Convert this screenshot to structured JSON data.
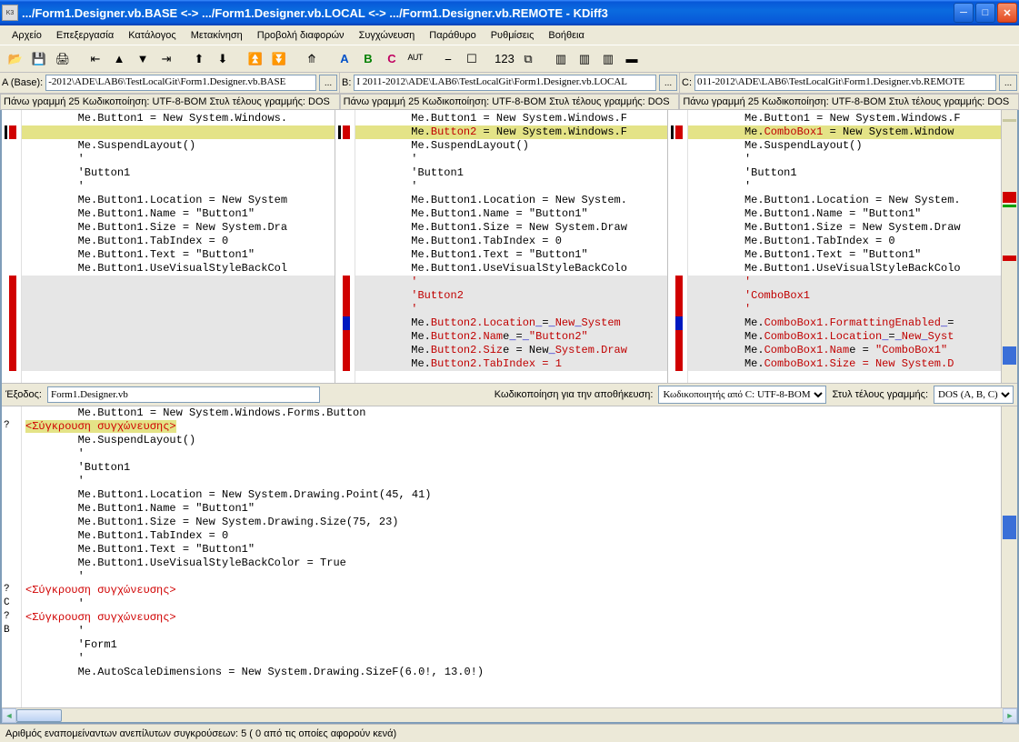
{
  "window": {
    "title": ".../Form1.Designer.vb.BASE <-> .../Form1.Designer.vb.LOCAL <-> .../Form1.Designer.vb.REMOTE - KDiff3",
    "appicon_text": "K3"
  },
  "menu": [
    "Αρχείο",
    "Επεξεργασία",
    "Κατάλογος",
    "Μετακίνηση",
    "Προβολή διαφορών",
    "Συγχώνευση",
    "Παράθυρο",
    "Ρυθμίσεις",
    "Βοήθεια"
  ],
  "toolbar": {
    "icons": [
      "open",
      "save",
      "print",
      "|",
      "goback",
      "goup",
      "godown",
      "gofwd",
      "|",
      "prevdiff",
      "nextdiff",
      "|",
      "prevconf",
      "nextconf",
      "|",
      "autosolve",
      "|",
      "A",
      "B",
      "C",
      "auto",
      "|",
      "ws1",
      "ws2",
      "|",
      "123",
      "split",
      "|",
      "col1",
      "col2",
      "col3",
      "hsplit"
    ]
  },
  "paths": {
    "A": {
      "label": "A (Base):",
      "value": "-2012\\ADE\\LAB6\\TestLocalGit\\Form1.Designer.vb.BASE",
      "btn": "..."
    },
    "B": {
      "label": "B:",
      "value": "I 2011-2012\\ADE\\LAB6\\TestLocalGit\\Form1.Designer.vb.LOCAL",
      "btn": "..."
    },
    "C": {
      "label": "C:",
      "value": "011-2012\\ADE\\LAB6\\TestLocalGit\\Form1.Designer.vb.REMOTE",
      "btn": "..."
    }
  },
  "info": {
    "A": "Πάνω γραμμή 25   Κωδικοποίηση: UTF-8-BOM Στυλ τέλους γραμμής: DOS",
    "B": "Πάνω γραμμή 25   Κωδικοποίηση: UTF-8-BOM Στυλ τέλους γραμμής: DOS",
    "C": "Πάνω γραμμή 25   Κωδικοποίηση: UTF-8-BOM Στυλ τέλους γραμμής: DOS"
  },
  "paneA": {
    "lines": [
      {
        "t": "        Me.Button1 = New System.Windows.",
        "cls": ""
      },
      {
        "t": " ",
        "cls": "hl-yellow"
      },
      {
        "t": "        Me.SuspendLayout()",
        "cls": ""
      },
      {
        "t": "        '",
        "cls": ""
      },
      {
        "t": "        'Button1",
        "cls": ""
      },
      {
        "t": "        '",
        "cls": ""
      },
      {
        "t": "        Me.Button1.Location = New System",
        "cls": ""
      },
      {
        "t": "        Me.Button1.Name = \"Button1\"",
        "cls": ""
      },
      {
        "t": "        Me.Button1.Size = New System.Dra",
        "cls": ""
      },
      {
        "t": "        Me.Button1.TabIndex = 0",
        "cls": ""
      },
      {
        "t": "        Me.Button1.Text = \"Button1\"",
        "cls": ""
      },
      {
        "t": "        Me.Button1.UseVisualStyleBackCol",
        "cls": ""
      },
      {
        "t": " ",
        "cls": "hl-grey"
      },
      {
        "t": " ",
        "cls": "hl-grey"
      },
      {
        "t": " ",
        "cls": "hl-grey"
      },
      {
        "t": " ",
        "cls": "hl-grey"
      },
      {
        "t": " ",
        "cls": "hl-grey"
      },
      {
        "t": " ",
        "cls": "hl-grey"
      },
      {
        "t": " ",
        "cls": "hl-grey"
      }
    ]
  },
  "paneB": {
    "lines": [
      {
        "html": "        Me.Button1 = New System.Windows.F",
        "cls": ""
      },
      {
        "html": "        Me.<span class='tok-red'>Button2</span> = New System.Windows.F",
        "cls": "hl-yellow"
      },
      {
        "html": "        Me.SuspendLayout()",
        "cls": ""
      },
      {
        "html": "        '",
        "cls": ""
      },
      {
        "html": "        'Button1",
        "cls": ""
      },
      {
        "html": "        '",
        "cls": ""
      },
      {
        "html": "        Me.Button1.Location = New System.",
        "cls": ""
      },
      {
        "html": "        Me.Button1.Name = \"Button1\"",
        "cls": ""
      },
      {
        "html": "        Me.Button1.Size = New System.Draw",
        "cls": ""
      },
      {
        "html": "        Me.Button1.TabIndex = 0",
        "cls": ""
      },
      {
        "html": "        Me.Button1.Text = \"Button1\"",
        "cls": ""
      },
      {
        "html": "        Me.Button1.UseVisualStyleBackColo",
        "cls": ""
      },
      {
        "html": "        <span class='tok-red'>'</span>",
        "cls": "hl-grey"
      },
      {
        "html": "        <span class='tok-red'>'Button2</span>",
        "cls": "hl-grey"
      },
      {
        "html": "        <span class='tok-red'>'</span>",
        "cls": "hl-grey"
      },
      {
        "html": "        Me.<span class='tok-red'>Button2.Location</span><span class='tok-blue'>_</span>=<span class='tok-blue'>_</span><span class='tok-red'>New</span><span class='tok-blue'>_</span><span class='tok-red'>System</span>",
        "cls": "hl-grey"
      },
      {
        "html": "        Me.<span class='tok-red'>Button2.Nam</span><span class='tok-black'>e</span><span class='tok-blue'>_</span>=<span class='tok-blue'>_</span><span class='tok-red'>\"Button2\"</span>",
        "cls": "hl-grey"
      },
      {
        "html": "        Me.<span class='tok-red'>Button2.Siz</span><span class='tok-black'>e</span> = New<span class='tok-blue'>_</span><span class='tok-red'>System.Draw</span>",
        "cls": "hl-grey"
      },
      {
        "html": "        Me.<span class='tok-red'>Button2.TabIndex = 1</span>",
        "cls": "hl-grey"
      }
    ]
  },
  "paneC": {
    "lines": [
      {
        "html": "        Me.Button1 = New System.Windows.F",
        "cls": ""
      },
      {
        "html": "        Me.<span class='tok-red'>ComboBox1</span> = New System.Window",
        "cls": "hl-yellow"
      },
      {
        "html": "        Me.SuspendLayout()",
        "cls": ""
      },
      {
        "html": "        '",
        "cls": ""
      },
      {
        "html": "        'Button1",
        "cls": ""
      },
      {
        "html": "        '",
        "cls": ""
      },
      {
        "html": "        Me.Button1.Location = New System.",
        "cls": ""
      },
      {
        "html": "        Me.Button1.Name = \"Button1\"",
        "cls": ""
      },
      {
        "html": "        Me.Button1.Size = New System.Draw",
        "cls": ""
      },
      {
        "html": "        Me.Button1.TabIndex = 0",
        "cls": ""
      },
      {
        "html": "        Me.Button1.Text = \"Button1\"",
        "cls": ""
      },
      {
        "html": "        Me.Button1.UseVisualStyleBackColo",
        "cls": ""
      },
      {
        "html": "        <span class='tok-red'>'</span>",
        "cls": "hl-grey"
      },
      {
        "html": "        <span class='tok-red'>'ComboBox1</span>",
        "cls": "hl-grey"
      },
      {
        "html": "        <span class='tok-red'>'</span>",
        "cls": "hl-grey"
      },
      {
        "html": "        Me.<span class='tok-red'>ComboBox1.FormattingEnabled</span><span class='tok-blue'>_</span>=",
        "cls": "hl-grey"
      },
      {
        "html": "        Me.<span class='tok-red'>ComboBox1.Location</span><span class='tok-blue'>_</span>=<span class='tok-blue'>_</span><span class='tok-red'>New</span><span class='tok-blue'>_</span><span class='tok-red'>Syst</span>",
        "cls": "hl-grey"
      },
      {
        "html": "        Me.<span class='tok-red'>ComboBox1.Nam</span><span class='tok-black'>e</span> = <span class='tok-red'>\"ComboBox1\"</span>",
        "cls": "hl-grey"
      },
      {
        "html": "        Me.<span class='tok-red'>ComboBox1.Size = New System.D</span>",
        "cls": "hl-grey"
      }
    ]
  },
  "midbar": {
    "output_label": "Έξοδος:",
    "output_value": "Form1.Designer.vb",
    "enc_label": "Κωδικοποίηση για την αποθήκευση:",
    "enc_value": "Κωδικοποιητής από C: UTF-8-BOM",
    "eol_label": "Στυλ τέλους γραμμής:",
    "eol_value": "DOS (A, B, C)"
  },
  "merge": {
    "lines": [
      {
        "g": "",
        "html": "        Me.Button1 = New System.Windows.Forms.Button"
      },
      {
        "g": "?",
        "html": "<span class='conflict'>&lt;Σύγκρουση συγχώνευσης&gt;</span>"
      },
      {
        "g": "",
        "html": "        Me.SuspendLayout()"
      },
      {
        "g": "",
        "html": "        '"
      },
      {
        "g": "",
        "html": "        'Button1"
      },
      {
        "g": "",
        "html": "        '"
      },
      {
        "g": "",
        "html": "        Me.Button1.Location = New System.Drawing.Point(45, 41)"
      },
      {
        "g": "",
        "html": "        Me.Button1.Name = \"Button1\""
      },
      {
        "g": "",
        "html": "        Me.Button1.Size = New System.Drawing.Size(75, 23)"
      },
      {
        "g": "",
        "html": "        Me.Button1.TabIndex = 0"
      },
      {
        "g": "",
        "html": "        Me.Button1.Text = \"Button1\""
      },
      {
        "g": "",
        "html": "        Me.Button1.UseVisualStyleBackColor = True"
      },
      {
        "g": "",
        "html": "        '"
      },
      {
        "g": "?",
        "html": "<span class='conflict2'>&lt;Σύγκρουση συγχώνευσης&gt;</span>"
      },
      {
        "g": "C",
        "html": "        '"
      },
      {
        "g": "?",
        "html": "<span class='conflict2'>&lt;Σύγκρουση συγχώνευσης&gt;</span>"
      },
      {
        "g": "B",
        "html": "        '"
      },
      {
        "g": "",
        "html": "        'Form1"
      },
      {
        "g": "",
        "html": "        '"
      },
      {
        "g": "",
        "html": "        Me.AutoScaleDimensions = New System.Drawing.SizeF(6.0!, 13.0!)"
      }
    ]
  },
  "status": "Αριθμός εναπομείναντων ανεπίλυτων συγκρούσεων: 5 ( 0 από τις οποίες αφορούν κενά)"
}
